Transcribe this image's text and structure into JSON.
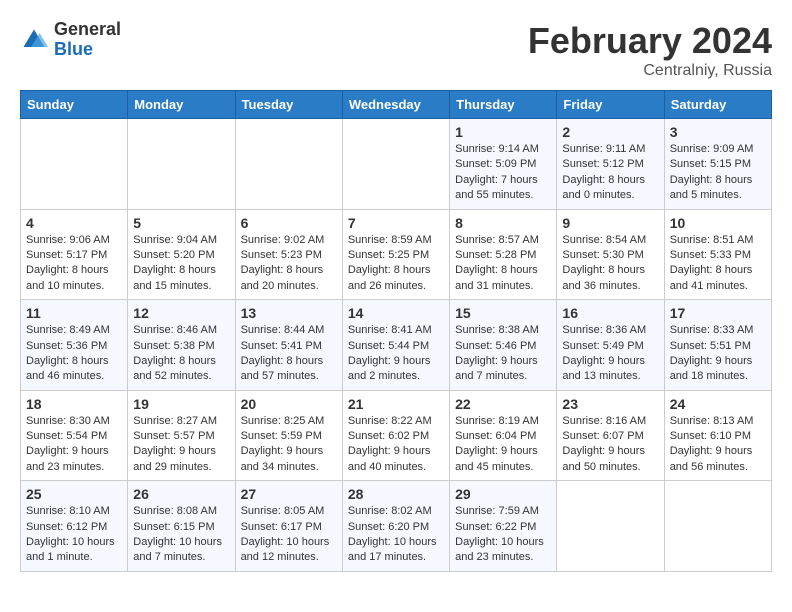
{
  "header": {
    "logo_general": "General",
    "logo_blue": "Blue",
    "month_title": "February 2024",
    "subtitle": "Centralniy, Russia"
  },
  "days_of_week": [
    "Sunday",
    "Monday",
    "Tuesday",
    "Wednesday",
    "Thursday",
    "Friday",
    "Saturday"
  ],
  "weeks": [
    [
      {
        "day": "",
        "info": ""
      },
      {
        "day": "",
        "info": ""
      },
      {
        "day": "",
        "info": ""
      },
      {
        "day": "",
        "info": ""
      },
      {
        "day": "1",
        "info": "Sunrise: 9:14 AM\nSunset: 5:09 PM\nDaylight: 7 hours\nand 55 minutes."
      },
      {
        "day": "2",
        "info": "Sunrise: 9:11 AM\nSunset: 5:12 PM\nDaylight: 8 hours\nand 0 minutes."
      },
      {
        "day": "3",
        "info": "Sunrise: 9:09 AM\nSunset: 5:15 PM\nDaylight: 8 hours\nand 5 minutes."
      }
    ],
    [
      {
        "day": "4",
        "info": "Sunrise: 9:06 AM\nSunset: 5:17 PM\nDaylight: 8 hours\nand 10 minutes."
      },
      {
        "day": "5",
        "info": "Sunrise: 9:04 AM\nSunset: 5:20 PM\nDaylight: 8 hours\nand 15 minutes."
      },
      {
        "day": "6",
        "info": "Sunrise: 9:02 AM\nSunset: 5:23 PM\nDaylight: 8 hours\nand 20 minutes."
      },
      {
        "day": "7",
        "info": "Sunrise: 8:59 AM\nSunset: 5:25 PM\nDaylight: 8 hours\nand 26 minutes."
      },
      {
        "day": "8",
        "info": "Sunrise: 8:57 AM\nSunset: 5:28 PM\nDaylight: 8 hours\nand 31 minutes."
      },
      {
        "day": "9",
        "info": "Sunrise: 8:54 AM\nSunset: 5:30 PM\nDaylight: 8 hours\nand 36 minutes."
      },
      {
        "day": "10",
        "info": "Sunrise: 8:51 AM\nSunset: 5:33 PM\nDaylight: 8 hours\nand 41 minutes."
      }
    ],
    [
      {
        "day": "11",
        "info": "Sunrise: 8:49 AM\nSunset: 5:36 PM\nDaylight: 8 hours\nand 46 minutes."
      },
      {
        "day": "12",
        "info": "Sunrise: 8:46 AM\nSunset: 5:38 PM\nDaylight: 8 hours\nand 52 minutes."
      },
      {
        "day": "13",
        "info": "Sunrise: 8:44 AM\nSunset: 5:41 PM\nDaylight: 8 hours\nand 57 minutes."
      },
      {
        "day": "14",
        "info": "Sunrise: 8:41 AM\nSunset: 5:44 PM\nDaylight: 9 hours\nand 2 minutes."
      },
      {
        "day": "15",
        "info": "Sunrise: 8:38 AM\nSunset: 5:46 PM\nDaylight: 9 hours\nand 7 minutes."
      },
      {
        "day": "16",
        "info": "Sunrise: 8:36 AM\nSunset: 5:49 PM\nDaylight: 9 hours\nand 13 minutes."
      },
      {
        "day": "17",
        "info": "Sunrise: 8:33 AM\nSunset: 5:51 PM\nDaylight: 9 hours\nand 18 minutes."
      }
    ],
    [
      {
        "day": "18",
        "info": "Sunrise: 8:30 AM\nSunset: 5:54 PM\nDaylight: 9 hours\nand 23 minutes."
      },
      {
        "day": "19",
        "info": "Sunrise: 8:27 AM\nSunset: 5:57 PM\nDaylight: 9 hours\nand 29 minutes."
      },
      {
        "day": "20",
        "info": "Sunrise: 8:25 AM\nSunset: 5:59 PM\nDaylight: 9 hours\nand 34 minutes."
      },
      {
        "day": "21",
        "info": "Sunrise: 8:22 AM\nSunset: 6:02 PM\nDaylight: 9 hours\nand 40 minutes."
      },
      {
        "day": "22",
        "info": "Sunrise: 8:19 AM\nSunset: 6:04 PM\nDaylight: 9 hours\nand 45 minutes."
      },
      {
        "day": "23",
        "info": "Sunrise: 8:16 AM\nSunset: 6:07 PM\nDaylight: 9 hours\nand 50 minutes."
      },
      {
        "day": "24",
        "info": "Sunrise: 8:13 AM\nSunset: 6:10 PM\nDaylight: 9 hours\nand 56 minutes."
      }
    ],
    [
      {
        "day": "25",
        "info": "Sunrise: 8:10 AM\nSunset: 6:12 PM\nDaylight: 10 hours\nand 1 minute."
      },
      {
        "day": "26",
        "info": "Sunrise: 8:08 AM\nSunset: 6:15 PM\nDaylight: 10 hours\nand 7 minutes."
      },
      {
        "day": "27",
        "info": "Sunrise: 8:05 AM\nSunset: 6:17 PM\nDaylight: 10 hours\nand 12 minutes."
      },
      {
        "day": "28",
        "info": "Sunrise: 8:02 AM\nSunset: 6:20 PM\nDaylight: 10 hours\nand 17 minutes."
      },
      {
        "day": "29",
        "info": "Sunrise: 7:59 AM\nSunset: 6:22 PM\nDaylight: 10 hours\nand 23 minutes."
      },
      {
        "day": "",
        "info": ""
      },
      {
        "day": "",
        "info": ""
      }
    ]
  ]
}
